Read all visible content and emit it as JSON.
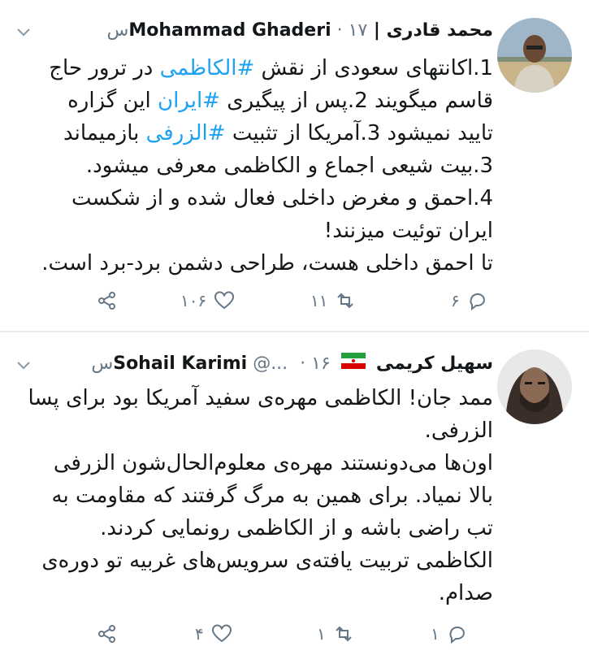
{
  "tweets": [
    {
      "author_name": "محمد قادری | Mohammad Ghaderi",
      "handle": "",
      "dot": "·",
      "time": "۱۷س",
      "body_lines": [
        [
          "1.اکانتهای سعودی از نقش ",
          {
            "tag": "#الکاظمی"
          },
          " در ترور حاج"
        ],
        [
          "قاسم میگویند 2.پس از پیگیری ",
          {
            "tag": "#ایران"
          },
          " این گزاره"
        ],
        [
          "تایید نمیشود 3.آمریکا از تثبیت ",
          {
            "tag": "#الزرفی"
          },
          " بازمیماند"
        ],
        [
          "3.بیت شیعی اجماع و الکاظمی معرفی میشود."
        ],
        [
          "4.احمق و مغرض داخلی فعال شده و از شکست"
        ],
        [
          "ایران توئیت میزنند!"
        ],
        [
          "تا احمق داخلی هست، طراحی دشمن برد-برد است."
        ]
      ],
      "replies": "۶",
      "retweets": "۱۱",
      "likes": "۱۰۶"
    },
    {
      "author_name": "سهیل کریمی",
      "author_name_latin": "Sohail Karimi",
      "handle": "@...",
      "dot": "·",
      "time": "۱۶س",
      "body_lines": [
        [
          "ممد جان! الکاظمی مهره‌ی سفید آمریکا بود برای پسا"
        ],
        [
          "الزرفی."
        ],
        [
          "اون‌ها می‌دونستند مهره‌ی معلوم‌الحال‌شون الزرفی"
        ],
        [
          "بالا نمیاد. برای همین به مرگ گرفتند که مقاومت به"
        ],
        [
          "تب راضی باشه و از الکاظمی رونمایی کردند."
        ],
        [
          "الکاظمی تربیت یافته‌ی سرویس‌های غربیه تو دوره‌ی"
        ],
        [
          "صدام."
        ]
      ],
      "replies": "۱",
      "retweets": "۱",
      "likes": "۴"
    }
  ],
  "icons": {
    "reply": "reply-icon",
    "retweet": "retweet-icon",
    "like": "heart-icon",
    "share": "share-icon",
    "menu": "chevron-down-icon",
    "flag": "iran-flag-icon"
  },
  "colors": {
    "hashtag": "#1da1f2",
    "meta": "#657786",
    "divider": "#e6ecf0"
  }
}
